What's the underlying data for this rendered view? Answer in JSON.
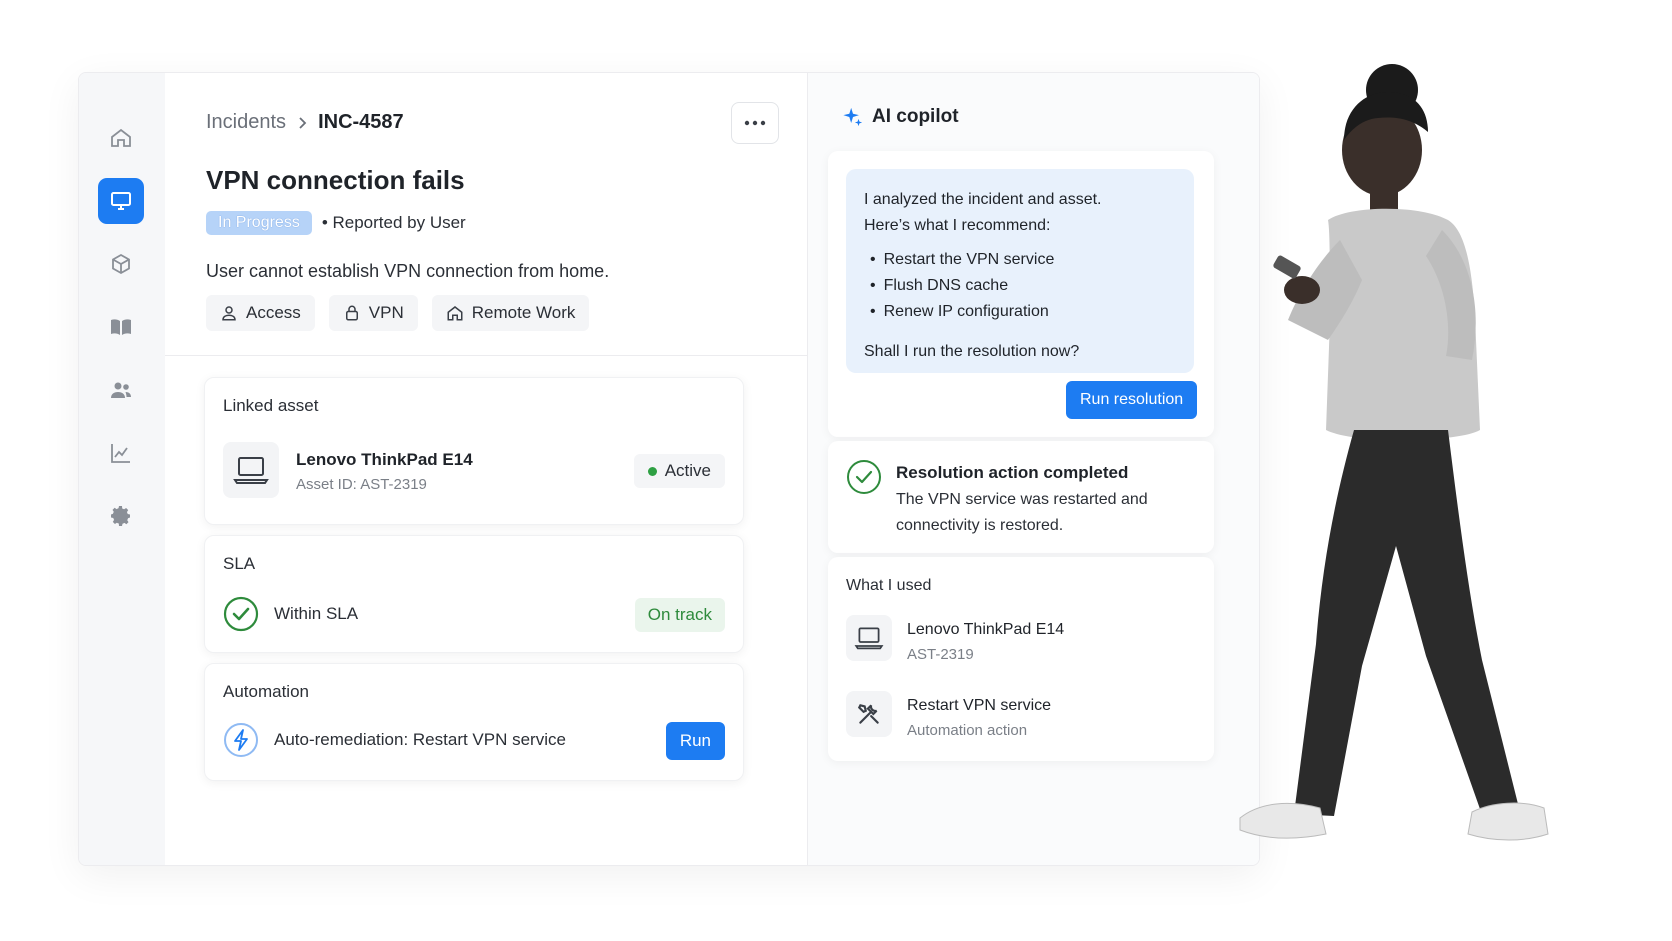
{
  "breadcrumb": {
    "root": "Incidents",
    "current": "INC-4587"
  },
  "incident": {
    "title": "VPN connection fails",
    "status": "In Progress",
    "reported_by": "• Reported by User",
    "description": "User cannot establish VPN connection from home.",
    "tags": [
      {
        "label": "Access",
        "icon": "user-icon"
      },
      {
        "label": "VPN",
        "icon": "lock-icon"
      },
      {
        "label": "Remote Work",
        "icon": "home-icon"
      }
    ]
  },
  "linked_asset": {
    "title": "Linked asset",
    "name": "Lenovo ThinkPad E14",
    "id": "Asset ID: AST-2319",
    "status": "Active"
  },
  "sla": {
    "title": "SLA",
    "text": "Within SLA",
    "badge": "On track"
  },
  "automation": {
    "title": "Automation",
    "text": "Auto-remediation: Restart VPN service",
    "button": "Run"
  },
  "copilot": {
    "title": "AI copilot",
    "intro_1": "I analyzed the incident and asset.",
    "intro_2": "Here’s what I recommend:",
    "recommendations": [
      "Restart the VPN service",
      "Flush DNS cache",
      "Renew IP configuration"
    ],
    "question": "Shall I run the resolution now?",
    "run_button": "Run resolution",
    "result_title": "Resolution action completed",
    "result_body": "The VPN service was restarted and connectivity is restored.",
    "used_title": "What I used",
    "used": [
      {
        "name": "Lenovo ThinkPad E14",
        "sub": "AST-2319",
        "icon": "laptop-icon"
      },
      {
        "name": "Restart VPN service",
        "sub": "Automation action",
        "icon": "tools-icon"
      }
    ]
  },
  "sidebar": {
    "items": [
      "home-icon",
      "monitor-icon",
      "cube-icon",
      "book-icon",
      "users-icon",
      "chart-icon",
      "gear-icon"
    ]
  },
  "colors": {
    "accent": "#1d7cf2",
    "success": "#2e8b3c",
    "status_pill": "#b6d3f8"
  }
}
